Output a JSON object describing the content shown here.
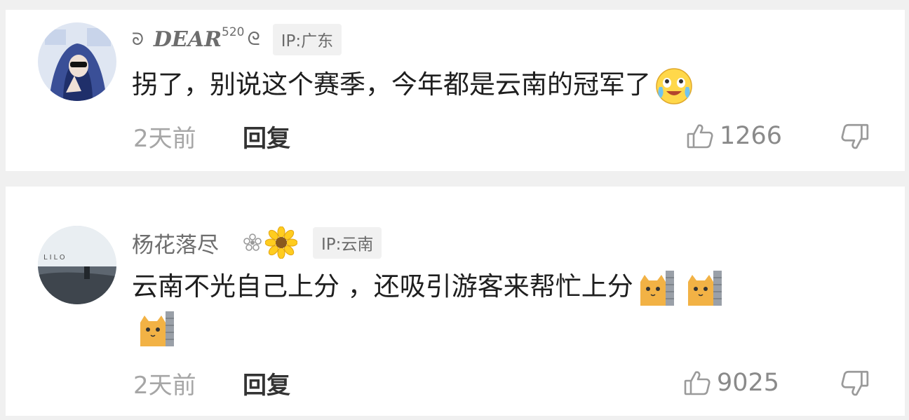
{
  "comments": [
    {
      "username_prefix_icon": "ornament-icon",
      "username": "DEAR",
      "username_sup": "520",
      "username_suffix_icon": "swirl-icon",
      "ip": "IP:广东",
      "text": "拐了，别说这个赛季，今年都是云南的冠军了",
      "emojis": [
        "laugh-cry-emoji"
      ],
      "time": "2天前",
      "reply_label": "回复",
      "likes": "1266"
    },
    {
      "username": "杨花落尽",
      "badges": [
        "flower-outline-icon",
        "sunflower-icon"
      ],
      "ip": "IP:云南",
      "text": "云南不光自己上分 ，还吸引游客来帮忙上分",
      "emojis": [
        "cat-peek-emoji",
        "cat-peek-emoji",
        "cat-peek-emoji"
      ],
      "time": "2天前",
      "reply_label": "回复",
      "likes": "9025"
    }
  ],
  "colors": {
    "background": "#f0f0f0",
    "card": "#ffffff",
    "username": "#6d6d6d",
    "comment_text": "#1e1e1e",
    "meta": "#a6a6a6",
    "ip_badge_bg": "#f1f1f1"
  }
}
